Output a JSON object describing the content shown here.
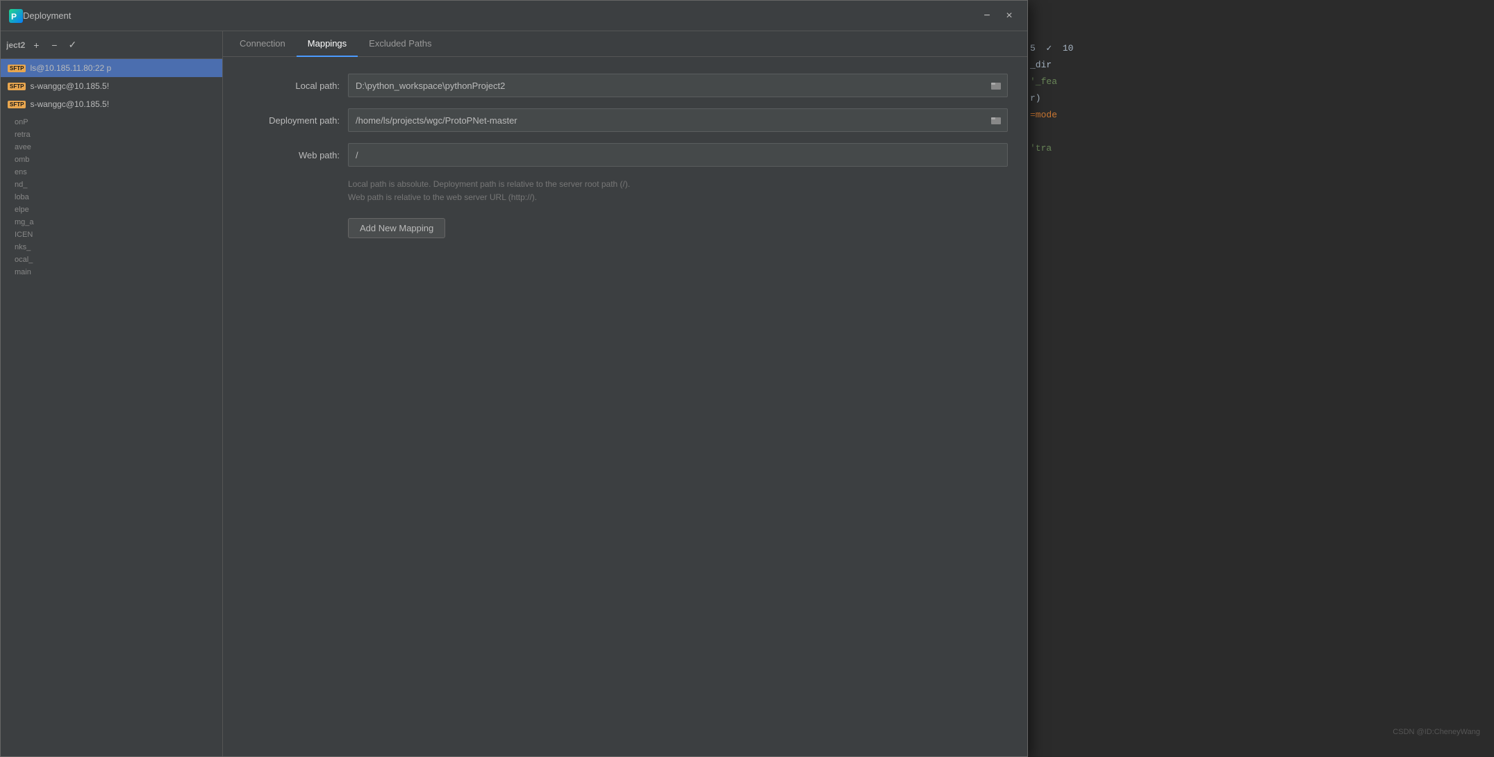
{
  "dialog": {
    "title": "Deployment",
    "close_label": "×",
    "minimize_label": "−"
  },
  "tabs": {
    "connection": "Connection",
    "mappings": "Mappings",
    "excluded_paths": "Excluded Paths",
    "active": "mappings"
  },
  "sidebar": {
    "title": "ject2",
    "add_btn": "+",
    "remove_btn": "−",
    "check_btn": "✓",
    "servers": [
      {
        "label": "ls@10.185.11.80:22 p",
        "selected": true
      },
      {
        "label": "s-wanggc@10.185.5!",
        "selected": false
      },
      {
        "label": "s-wanggc@10.185.5!",
        "selected": false
      }
    ],
    "file_items": [
      "onP",
      "retr",
      "avee",
      "omb",
      "ens",
      "nd_",
      "loba",
      "elpe",
      "mg_a",
      "ICEN",
      "nks_",
      "ocal_",
      "main"
    ]
  },
  "mappings": {
    "local_path_label": "Local path:",
    "local_path_underline": "L",
    "local_path_value": "D:\\python_workspace\\pythonProject2",
    "deployment_path_label": "Deployment path:",
    "deployment_path_underline": "D",
    "deployment_path_value": "/home/ls/projects/wgc/ProtoPNet-master",
    "web_path_label": "Web path:",
    "web_path_underline": "W",
    "web_path_value": "/",
    "hint_line1": "Local path is absolute. Deployment path is relative to the server root path (/).",
    "hint_line2": "Web path is relative to the web server URL (http://).",
    "add_mapping_btn": "Add New Mapping"
  },
  "code_partial": {
    "lines": [
      {
        "text": "5  ✓  10",
        "class": "code-white"
      },
      {
        "text": "_dir",
        "class": "code-white"
      },
      {
        "text": "'_fea",
        "class": "code-green"
      },
      {
        "text": "r)",
        "class": "code-white"
      },
      {
        "text": "=mode",
        "class": "code-orange"
      },
      {
        "text": "",
        "class": ""
      },
      {
        "text": "'tra",
        "class": "code-green"
      }
    ]
  },
  "watermark": "CSDN @ID:CheneyWang"
}
